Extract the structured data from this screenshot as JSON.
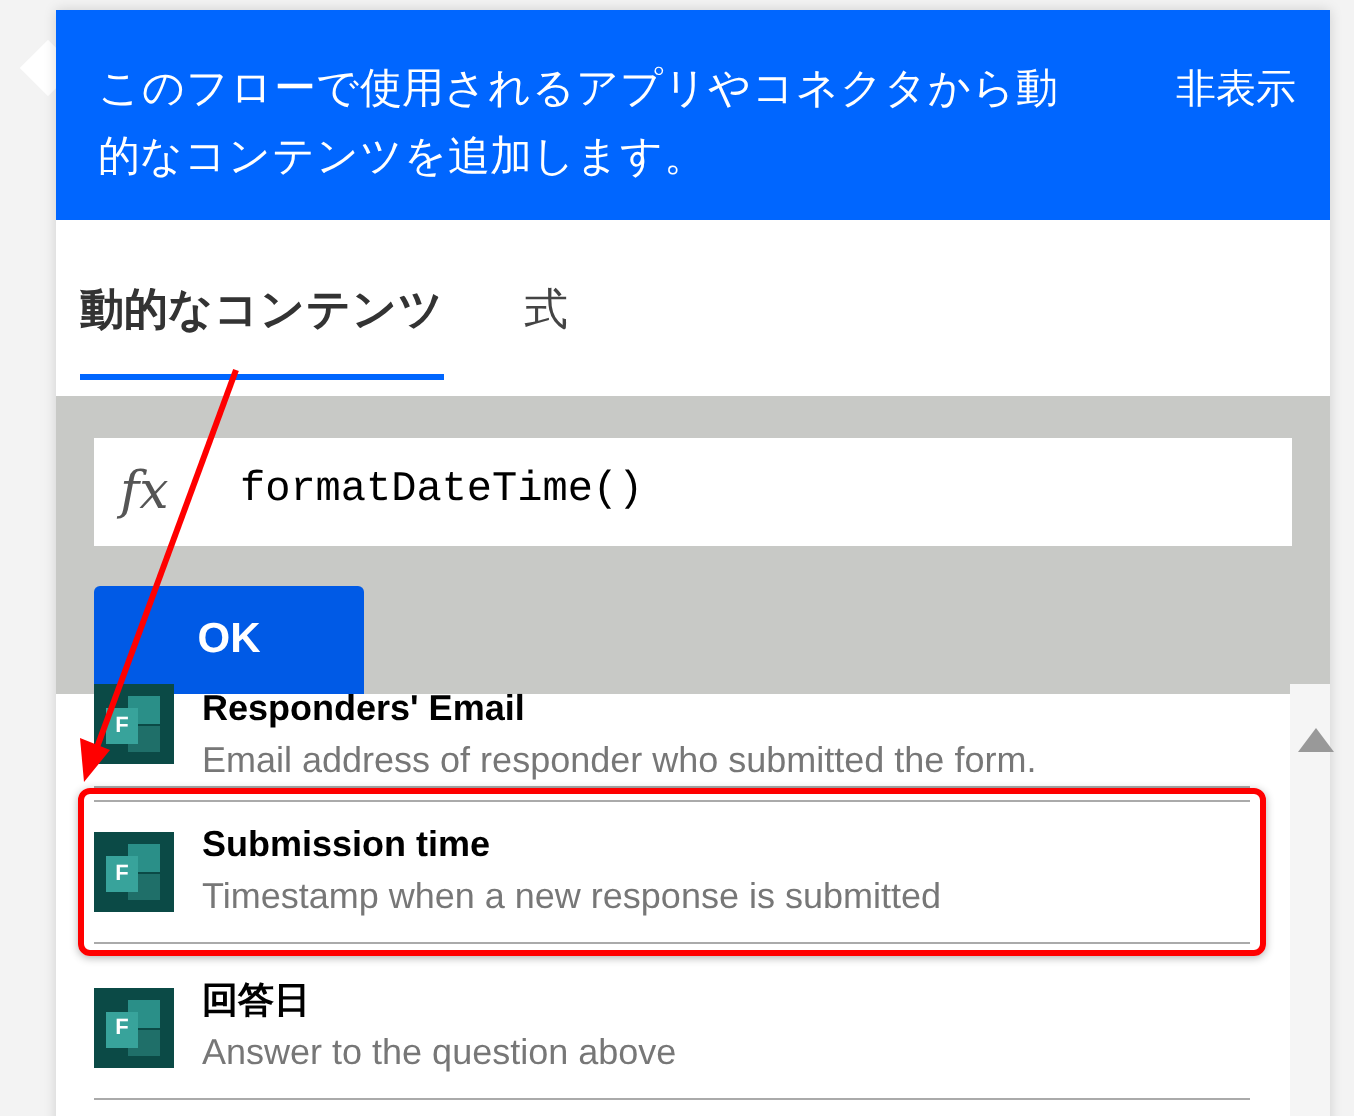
{
  "header": {
    "description": "このフローで使用されるアプリやコネクタから動的なコンテンツを追加します。",
    "hide_link": "非表示"
  },
  "tabs": [
    {
      "label": "動的なコンテンツ",
      "selected": true
    },
    {
      "label": "式",
      "selected": false
    }
  ],
  "expression": {
    "function_symbol": "fx",
    "value": "formatDateTime()",
    "ok_button": "OK"
  },
  "items": [
    {
      "title": "Responders' Email",
      "description": "Email address of responder who submitted the form.",
      "icon_letter": "F",
      "highlighted": false
    },
    {
      "title": "Submission time",
      "description": "Timestamp when a new response is submitted",
      "icon_letter": "F",
      "highlighted": true
    },
    {
      "title": "回答日",
      "description": "Answer to the question above",
      "icon_letter": "F",
      "highlighted": false
    }
  ]
}
